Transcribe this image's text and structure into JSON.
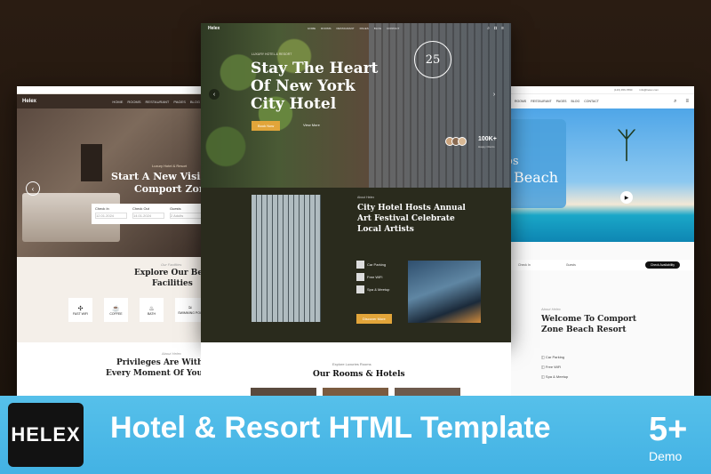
{
  "left": {
    "brand": "Helex",
    "nav": [
      "HOME",
      "ROOMS",
      "RESTAURANT",
      "PAGES",
      "BLOG"
    ],
    "hero_small": "Luxury Hotel & Resort",
    "hero_title_1": "Start A New Visi",
    "hero_title_2": "Comport Zon",
    "booking": [
      "Check In",
      "Check Out",
      "Guests"
    ],
    "booking_values": [
      "12.01.2024",
      "14.01.2024",
      "2 Adults"
    ],
    "facilities_small": "Our Facilities",
    "facilities_title_1": "Explore Our Be",
    "facilities_title_2": "Facilities",
    "facilities": [
      "FAST WIFI",
      "COFFEE",
      "BATH",
      "SWIMMING POO"
    ],
    "priv_small": "About Helex",
    "priv_title_1": "Privileges Are With",
    "priv_title_2": "Every Moment Of Your"
  },
  "center": {
    "brand": "Helex",
    "nav": [
      "HOME",
      "ROOMS",
      "RESTAURANT",
      "PAGES",
      "BLOG",
      "CONTACT"
    ],
    "hero_small": "LUXURY HOTEL & RESORT",
    "hero_title_1": "Stay The Heart",
    "hero_title_2": "Of New York",
    "hero_title_3": "City Hotel",
    "cta": "Book Now",
    "cta2": "View More",
    "badge_num": "25",
    "stat": "100K+",
    "stat_label": "Happy Clients",
    "about_small": "About Helex",
    "about_title_1": "City Hotel Hosts Annual",
    "about_title_2": "Art Festival Celebrate",
    "about_title_3": "Local Artists",
    "features": [
      "Car Parking",
      "Free WiFi",
      "Spa & Meetup"
    ],
    "about_btn": "Discover More",
    "rooms_small": "Explore Luxuries Rooms",
    "rooms_title": "Our Rooms & Hotels"
  },
  "right": {
    "phone": "(123) 456-7890",
    "email": "info@helex.com",
    "nav": [
      "ROOMS",
      "RESTAURANT",
      "PAGES",
      "BLOG",
      "CONTACT"
    ],
    "hero_title_1": "os",
    "hero_title_2": "Beach",
    "booking": [
      "Check In",
      "Guests"
    ],
    "check_btn": "Check Availability",
    "about_small": "About Helex",
    "about_title_1": "Welcome To Comport",
    "about_title_2": "Zone Beach Resort",
    "features": [
      "Car Parking",
      "Free WiFi",
      "Spa & Meetup"
    ]
  },
  "banner": {
    "logo": "HELEX",
    "title": "Hotel & Resort HTML Template",
    "count": "5+",
    "demo": "Demo"
  },
  "colors": {
    "accent": "#e2a53a",
    "banner": "#4ab8e6",
    "dark": "#2a2b1d"
  }
}
